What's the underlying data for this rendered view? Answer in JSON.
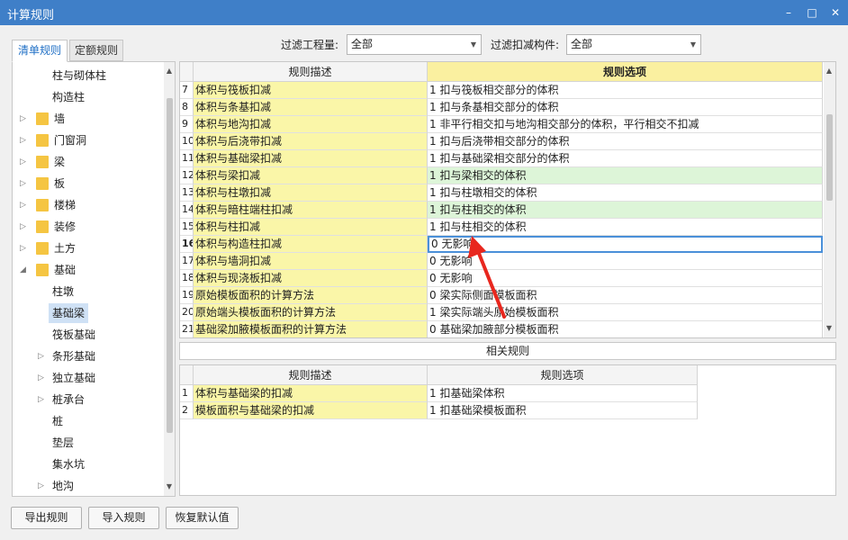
{
  "window": {
    "title": "计算规则",
    "minimize": "–",
    "maximize": "□",
    "close": "✕"
  },
  "tabs": [
    {
      "label": "清单规则",
      "active": true
    },
    {
      "label": "定额规则",
      "active": false
    }
  ],
  "tree": {
    "items": [
      {
        "label": "柱与砌体柱",
        "level": 2,
        "folder": false,
        "arrow": ""
      },
      {
        "label": "构造柱",
        "level": 2,
        "folder": false,
        "arrow": ""
      },
      {
        "label": "墙",
        "level": 1,
        "folder": true,
        "arrow": "▷"
      },
      {
        "label": "门窗洞",
        "level": 1,
        "folder": true,
        "arrow": "▷"
      },
      {
        "label": "梁",
        "level": 1,
        "folder": true,
        "arrow": "▷"
      },
      {
        "label": "板",
        "level": 1,
        "folder": true,
        "arrow": "▷"
      },
      {
        "label": "楼梯",
        "level": 1,
        "folder": true,
        "arrow": "▷"
      },
      {
        "label": "装修",
        "level": 1,
        "folder": true,
        "arrow": "▷"
      },
      {
        "label": "土方",
        "level": 1,
        "folder": true,
        "arrow": "▷"
      },
      {
        "label": "基础",
        "level": 1,
        "folder": true,
        "arrow": "◢"
      },
      {
        "label": "柱墩",
        "level": 2,
        "folder": false,
        "arrow": ""
      },
      {
        "label": "基础梁",
        "level": 2,
        "folder": false,
        "arrow": "",
        "selected": true
      },
      {
        "label": "筏板基础",
        "level": 2,
        "folder": false,
        "arrow": ""
      },
      {
        "label": "条形基础",
        "level": 2,
        "folder": false,
        "arrow": "▷"
      },
      {
        "label": "独立基础",
        "level": 2,
        "folder": false,
        "arrow": "▷"
      },
      {
        "label": "桩承台",
        "level": 2,
        "folder": false,
        "arrow": "▷"
      },
      {
        "label": "桩",
        "level": 2,
        "folder": false,
        "arrow": ""
      },
      {
        "label": "垫层",
        "level": 2,
        "folder": false,
        "arrow": ""
      },
      {
        "label": "集水坑",
        "level": 2,
        "folder": false,
        "arrow": ""
      },
      {
        "label": "地沟",
        "level": 2,
        "folder": false,
        "arrow": "▷"
      }
    ]
  },
  "filters": {
    "project_label": "过滤工程量:",
    "project_value": "全部",
    "component_label": "过滤扣减构件:",
    "component_value": "全部"
  },
  "main_grid": {
    "header_desc": "规则描述",
    "header_opt": "规则选项",
    "rows": [
      {
        "num": "7",
        "desc": "体积与筏板扣减",
        "opt": "1  扣与筏板相交部分的体积",
        "state": ""
      },
      {
        "num": "8",
        "desc": "体积与条基扣减",
        "opt": "1  扣与条基相交部分的体积",
        "state": ""
      },
      {
        "num": "9",
        "desc": "体积与地沟扣减",
        "opt": "1  非平行相交扣与地沟相交部分的体积，平行相交不扣减",
        "state": ""
      },
      {
        "num": "10",
        "desc": "体积与后浇带扣减",
        "opt": "1  扣与后浇带相交部分的体积",
        "state": ""
      },
      {
        "num": "11",
        "desc": "体积与基础梁扣减",
        "opt": "1  扣与基础梁相交部分的体积",
        "state": ""
      },
      {
        "num": "12",
        "desc": "体积与梁扣减",
        "opt": "1  扣与梁相交的体积",
        "state": "green"
      },
      {
        "num": "13",
        "desc": "体积与柱墩扣减",
        "opt": "1  扣与柱墩相交的体积",
        "state": ""
      },
      {
        "num": "14",
        "desc": "体积与暗柱端柱扣减",
        "opt": "1  扣与柱相交的体积",
        "state": "green"
      },
      {
        "num": "15",
        "desc": "体积与柱扣减",
        "opt": "1  扣与柱相交的体积",
        "state": ""
      },
      {
        "num": "16",
        "desc": "体积与构造柱扣减",
        "opt": "0   无影响",
        "state": "selrow"
      },
      {
        "num": "17",
        "desc": "体积与墙洞扣减",
        "opt": "0   无影响",
        "state": ""
      },
      {
        "num": "18",
        "desc": "体积与现浇板扣减",
        "opt": "0   无影响",
        "state": ""
      },
      {
        "num": "19",
        "desc": "原始模板面积的计算方法",
        "opt": "0  梁实际侧面模板面积",
        "state": ""
      },
      {
        "num": "20",
        "desc": "原始端头模板面积的计算方法",
        "opt": "1  梁实际端头原始模板面积",
        "state": ""
      },
      {
        "num": "21",
        "desc": "基础梁加腋模板面积的计算方法",
        "opt": "0  基础梁加腋部分模板面积",
        "state": ""
      }
    ]
  },
  "related": {
    "title": "相关规则",
    "header_desc": "规则描述",
    "header_opt": "规则选项",
    "rows": [
      {
        "num": "1",
        "desc": "体积与基础梁的扣减",
        "opt": "1  扣基础梁体积"
      },
      {
        "num": "2",
        "desc": "模板面积与基础梁的扣减",
        "opt": "1  扣基础梁模板面积"
      }
    ]
  },
  "buttons": {
    "export": "导出规则",
    "import": "导入规则",
    "restore": "恢复默认值"
  },
  "colors": {
    "title_bar": "#3f7fc8",
    "desc_cell": "#faf6a8",
    "highlight_row": "#ddf5d8",
    "annotation_arrow": "#e8271e"
  }
}
